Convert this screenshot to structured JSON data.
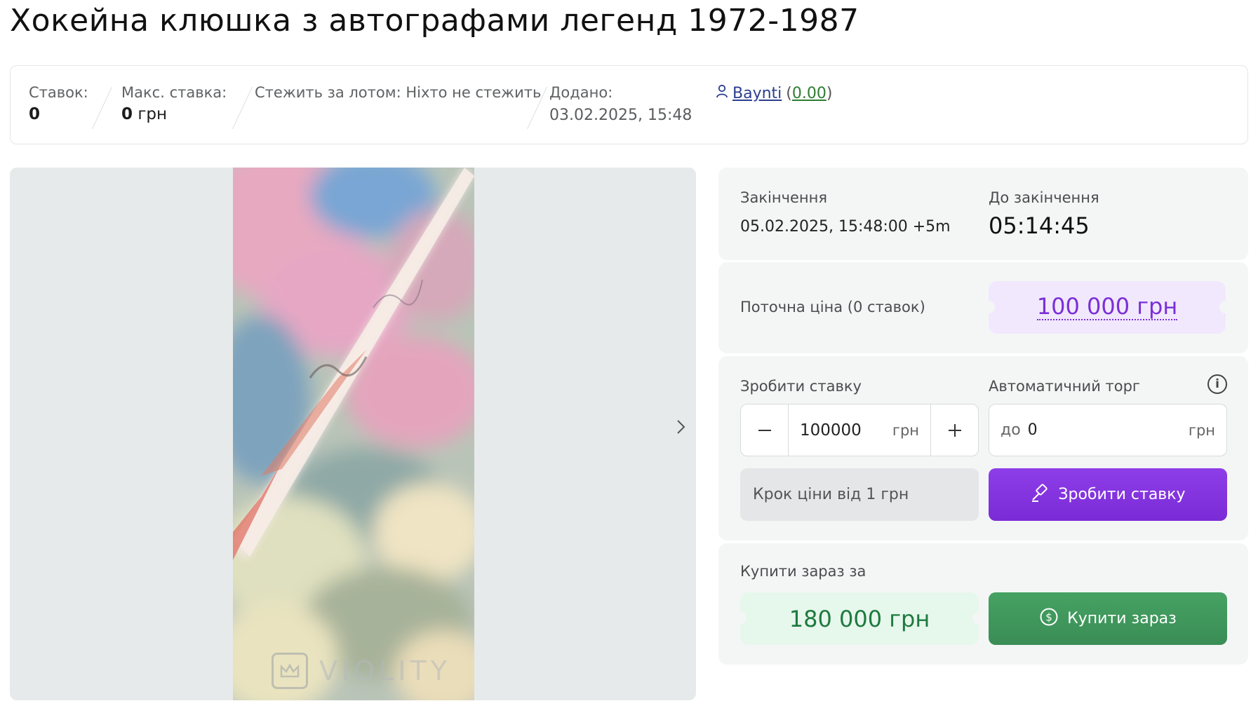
{
  "title": "Хокейна клюшка з автографами легенд 1972-1987",
  "info": {
    "bids_label": "Ставок:",
    "bids_value": "0",
    "max_bid_label": "Макс. ставка:",
    "max_bid_value": "0",
    "max_bid_currency": "грн",
    "watch_label": "Стежить за лотом: Ніхто не стежить",
    "added_label": "Додано:",
    "added_value": "03.02.2025, 15:48",
    "seller_name": "Baynti",
    "seller_rating": "0.00"
  },
  "gallery": {
    "watermark": "VIOLITY",
    "photo_index": 0
  },
  "timing": {
    "end_label": "Закінчення",
    "end_value": "05.02.2025, 15:48:00 +5m",
    "remaining_label": "До закінчення",
    "remaining_value": "05:14:45"
  },
  "current": {
    "label": "Поточна ціна (0 ставок)",
    "price": "100 000 грн"
  },
  "bid": {
    "label": "Зробити ставку",
    "value": "100000",
    "currency": "грн",
    "auto_label": "Автоматичний торг",
    "auto_prefix": "до",
    "auto_value": "0",
    "auto_currency": "грн",
    "step_note": "Крок ціни від 1 грн",
    "button": "Зробити ставку"
  },
  "buy": {
    "label": "Купити зараз за",
    "price": "180 000 грн",
    "button": "Купити зараз"
  },
  "colors": {
    "accent_purple": "#7b2bd6",
    "accent_green": "#3a8d55",
    "panel_bg": "#f4f6f6"
  }
}
